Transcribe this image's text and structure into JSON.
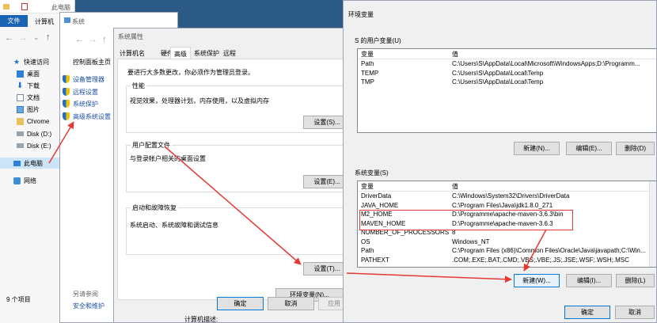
{
  "explorer": {
    "title": "此电脑",
    "ribbon_tabs": [
      "文件",
      "计算机"
    ],
    "quick_access": "快速访问",
    "nav": [
      "桌面",
      "下载",
      "文档",
      "图片",
      "Chrome",
      "Disk (D:)",
      "Disk (E:)"
    ],
    "this_pc": "此电脑",
    "network": "网络",
    "status": "9 个项目"
  },
  "system": {
    "title": "系统",
    "sidebar_home": "控制面板主页",
    "links": [
      "设备管理器",
      "远程设置",
      "系统保护",
      "高级系统设置"
    ],
    "see_also": "另请参阅",
    "security": "安全和维护",
    "behind_text": "计算机描述:"
  },
  "sysprops": {
    "title": "系统属性",
    "tabs": [
      "计算机名",
      "硬件",
      "高级",
      "系统保护",
      "远程"
    ],
    "note": "要进行大多数更改，你必须作为管理员登录。",
    "perf": {
      "title": "性能",
      "desc": "视觉效果，处理器计划，内存使用，以及虚拟内存",
      "btn": "设置(S)..."
    },
    "profile": {
      "title": "用户配置文件",
      "desc": "与登录帐户相关的桌面设置",
      "btn": "设置(E)..."
    },
    "startup": {
      "title": "启动和故障恢复",
      "desc": "系统启动、系统故障和调试信息",
      "btn": "设置(T)..."
    },
    "env_btn": "环境变量(N)...",
    "ok": "确定",
    "cancel": "取消",
    "apply": "应用"
  },
  "envvars": {
    "title": "环境变量",
    "user_section": "S 的用户变量(U)",
    "col_var": "变量",
    "col_val": "值",
    "user_rows": [
      {
        "name": "Path",
        "value": "C:\\Users\\S\\AppData\\Local\\Microsoft\\WindowsApps;D:\\Programm..."
      },
      {
        "name": "TEMP",
        "value": "C:\\Users\\S\\AppData\\Local\\Temp"
      },
      {
        "name": "TMP",
        "value": "C:\\Users\\S\\AppData\\Local\\Temp"
      }
    ],
    "user_buttons": [
      "新建(N)...",
      "编辑(E)...",
      "删除(D)"
    ],
    "sys_section": "系统变量(S)",
    "sys_rows": [
      {
        "name": "DriverData",
        "value": "C:\\Windows\\System32\\Drivers\\DriverData"
      },
      {
        "name": "JAVA_HOME",
        "value": "C:\\Program Files\\Java\\jdk1.8.0_271"
      },
      {
        "name": "M2_HOME",
        "value": "D:\\Programme\\apache-maven-3.6.3\\bin"
      },
      {
        "name": "MAVEN_HOME",
        "value": "D:\\Programme\\apache-maven-3.6.3"
      },
      {
        "name": "NUMBER_OF_PROCESSORS",
        "value": "8"
      },
      {
        "name": "OS",
        "value": "Windows_NT"
      },
      {
        "name": "Path",
        "value": "C:\\Program Files (x86)\\Common Files\\Oracle\\Java\\javapath;C:\\Win..."
      },
      {
        "name": "PATHEXT",
        "value": ".COM;.EXE;.BAT;.CMD;.VBS;.VBE;.JS;.JSE;.WSF;.WSH;.MSC"
      }
    ],
    "sys_buttons": [
      "新建(W)...",
      "编辑(I)...",
      "删除(L)"
    ],
    "ok": "确定",
    "cancel": "取消"
  },
  "colors": {
    "annotation": "#e53935",
    "accent": "#0078d7"
  }
}
